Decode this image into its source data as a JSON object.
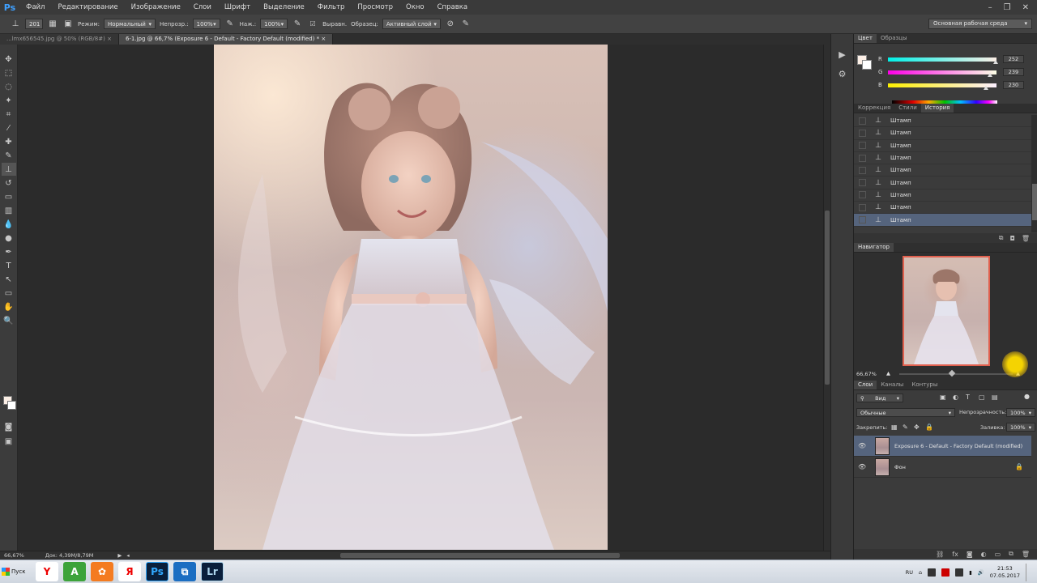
{
  "app": {
    "logo": "Ps",
    "menu": [
      "Файл",
      "Редактирование",
      "Изображение",
      "Слои",
      "Шрифт",
      "Выделение",
      "Фильтр",
      "Просмотр",
      "Окно",
      "Справка"
    ]
  },
  "options": {
    "brush_size": "201",
    "mode_label": "Режим:",
    "mode_value": "Нормальный",
    "opacity_label": "Непрозр.:",
    "opacity_value": "100%",
    "pressure_label": "Наж.:",
    "pressure_value": "100%",
    "aligned_label": "Выравн.",
    "sample_label": "Образец:",
    "sample_value": "Активный слой",
    "workspace": "Основная рабочая среда"
  },
  "tabs": [
    {
      "label": "...lmx656545.jpg @ 50% (RGB/8#)",
      "active": false
    },
    {
      "label": "6-1.jpg @ 66,7% (Exposure 6 - Default - Factory Default (modified) *",
      "active": true
    }
  ],
  "status": {
    "zoom": "66,67%",
    "doc": "Док: 4,39M/8,79M"
  },
  "color_panel": {
    "tabs": [
      "Цвет",
      "Образцы"
    ],
    "channels": [
      {
        "name": "R",
        "value": "252",
        "pct": 0.99
      },
      {
        "name": "G",
        "value": "239",
        "pct": 0.94
      },
      {
        "name": "B",
        "value": "230",
        "pct": 0.9
      }
    ]
  },
  "history_panel": {
    "tabs": [
      "Коррекция",
      "Стили",
      "История"
    ],
    "items": [
      "Штамп",
      "Штамп",
      "Штамп",
      "Штамп",
      "Штамп",
      "Штамп",
      "Штамп",
      "Штамп",
      "Штамп"
    ]
  },
  "navigator": {
    "title": "Навигатор",
    "zoom": "66,67%"
  },
  "layers_panel": {
    "tabs": [
      "Слои",
      "Каналы",
      "Контуры"
    ],
    "filter": "Вид",
    "blend": "Обычные",
    "opacity_label": "Непрозрачность:",
    "opacity_value": "100%",
    "lock_label": "Закрепить:",
    "fill_label": "Заливка:",
    "fill_value": "100%",
    "layers": [
      {
        "name": "Exposure 6 - Default - Factory Default (modified)",
        "selected": true
      },
      {
        "name": "Фон",
        "selected": false
      }
    ]
  },
  "taskbar": {
    "start": "Пуск",
    "apps": [
      "Y",
      "A",
      "✿",
      "Я",
      "Ps",
      "⧉",
      "Lr"
    ],
    "lang": "RU",
    "time": "21:53",
    "date": "07.05.2017"
  }
}
